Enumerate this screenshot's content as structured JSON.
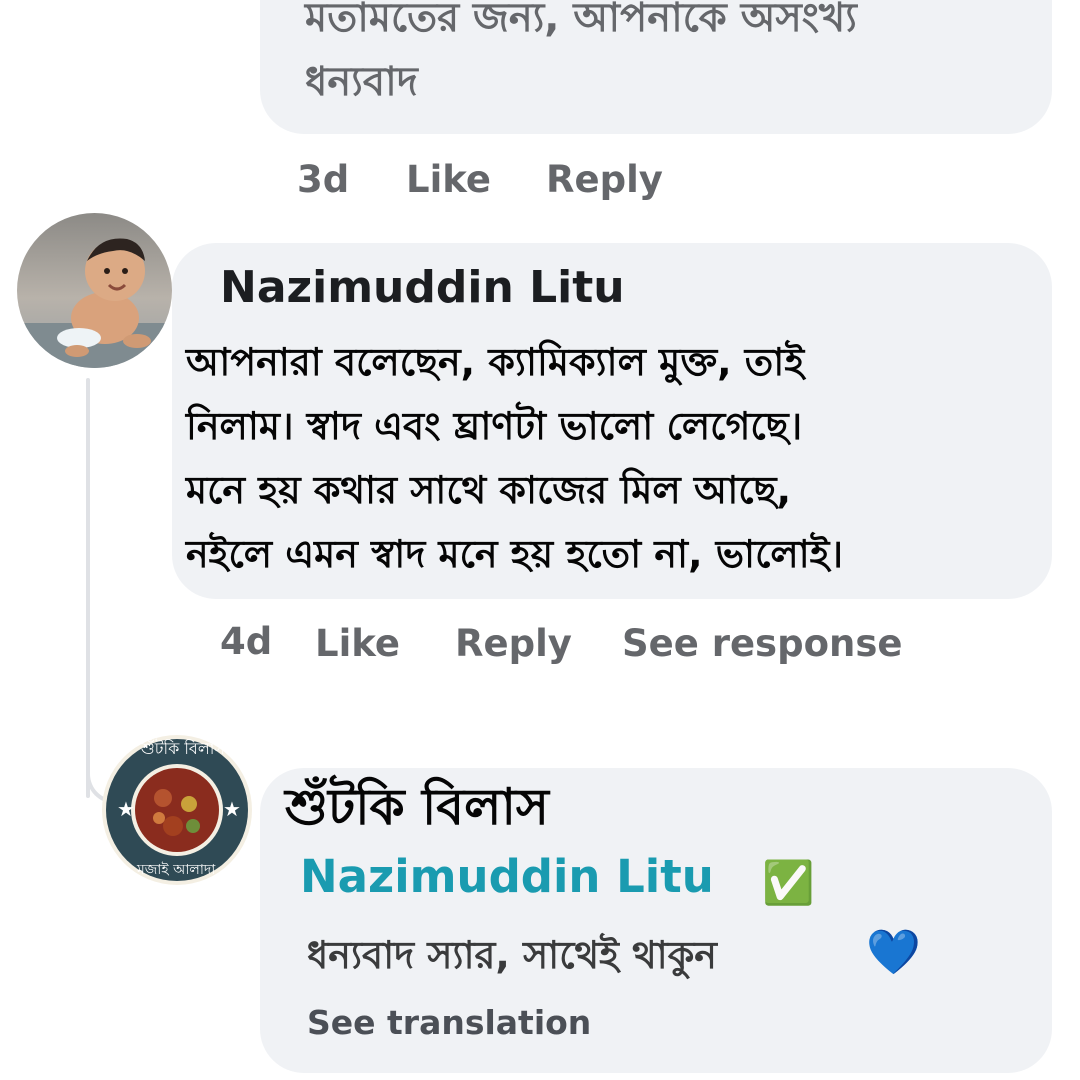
{
  "top_comment": {
    "text_line1": "মতামতের জন্য, আপনাকে অসংখ্য",
    "text_line2": "ধন্যবাদ",
    "time": "3d",
    "like_label": "Like",
    "reply_label": "Reply"
  },
  "comment": {
    "author": "Nazimuddin Litu",
    "lines": [
      "আপনারা বলেছেন, ক্যামিক্যাল মুক্ত, তাই",
      "নিলাম। স্বাদ এবং ঘ্রাণটা ভালো লেগেছে।",
      "মনে হয় কথার সাথে কাজের মিল আছে,",
      "নইলে এমন স্বাদ মনে হয় হতো না, ভালোই।"
    ],
    "time": "4d",
    "like_label": "Like",
    "reply_label": "Reply",
    "see_response_label": "See response"
  },
  "reply": {
    "page_name": "শুঁটকি বিলাস",
    "mention": "Nazimuddin Litu",
    "mention_icon": "✅",
    "text": "ধন্যবাদ স্যার, সাথেই থাকুন",
    "heart_icon": "💙",
    "see_translation_label": "See translation",
    "logo": {
      "top_text": "শুঁটকি বিলাস",
      "bottom_text": "মজাই আলাদা"
    }
  },
  "colors": {
    "bubble": "#f0f2f5",
    "meta": "#65676b",
    "mention": "#1a9bb0",
    "logo_ring": "#2f4a55"
  }
}
